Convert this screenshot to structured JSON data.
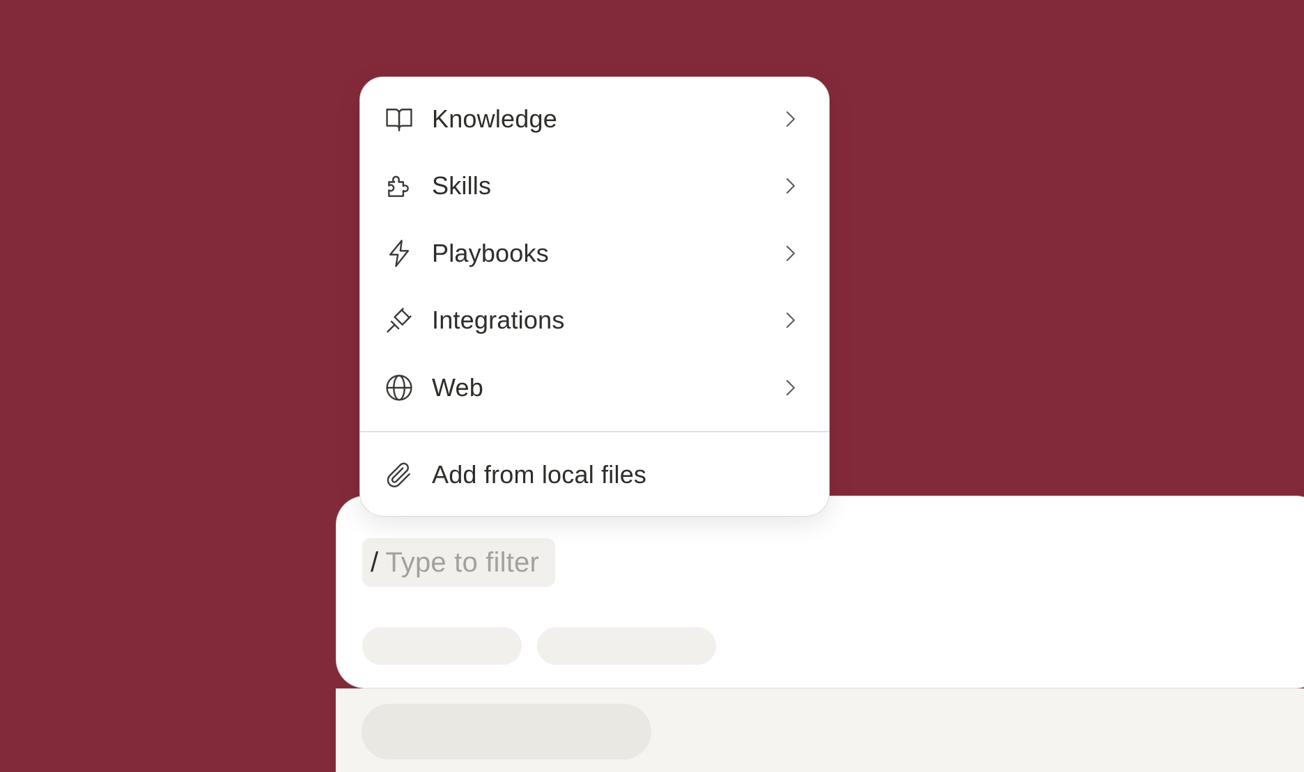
{
  "colors": {
    "background": "#832a3a",
    "text": "#2e2d2a",
    "placeholder": "#a3a19b",
    "surface": "#ffffff",
    "muted_surface": "#f1f0ec"
  },
  "menu": {
    "items": [
      {
        "label": "Knowledge",
        "icon": "book-open-icon",
        "has_submenu": true
      },
      {
        "label": "Skills",
        "icon": "puzzle-piece-icon",
        "has_submenu": true
      },
      {
        "label": "Playbooks",
        "icon": "lightning-bolt-icon",
        "has_submenu": true
      },
      {
        "label": "Integrations",
        "icon": "plug-icon",
        "has_submenu": true
      },
      {
        "label": "Web",
        "icon": "globe-icon",
        "has_submenu": true
      }
    ],
    "footer_item": {
      "label": "Add from local files",
      "icon": "paperclip-icon"
    }
  },
  "composer": {
    "filter_prefix": "/",
    "filter_placeholder": "Type to filter"
  }
}
